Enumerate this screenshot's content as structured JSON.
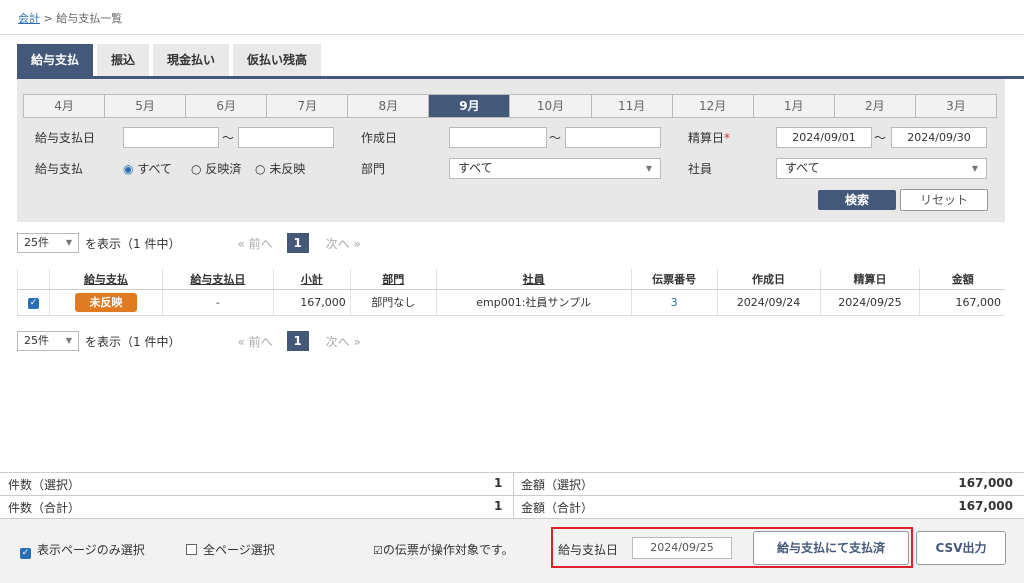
{
  "breadcrumb": {
    "root": "会計",
    "separator": ">",
    "current": "給与支払一覧"
  },
  "tabs": [
    "給与支払",
    "振込",
    "現金払い",
    "仮払い残高"
  ],
  "months": [
    "4月",
    "5月",
    "6月",
    "7月",
    "8月",
    "9月",
    "10月",
    "11月",
    "12月",
    "1月",
    "2月",
    "3月"
  ],
  "active_month": "9月",
  "filter": {
    "pay_date_label": "給与支払日",
    "pay_date_from": "",
    "pay_date_to": "",
    "created_label": "作成日",
    "created_from": "",
    "created_to": "",
    "settle_label": "精算日",
    "required_mark": "*",
    "settle_from": "2024/09/01",
    "settle_to": "2024/09/30",
    "tilde": "～",
    "payment_label": "給与支払",
    "radio_all": "すべて",
    "radio_applied": "反映済",
    "radio_unapplied": "未反映",
    "dept_label": "部門",
    "dept_value": "すべて",
    "employee_label": "社員",
    "employee_value": "すべて",
    "search_label": "検索",
    "reset_label": "リセット"
  },
  "pager": {
    "per_page": "25件",
    "display_text": "を表示（1 件中）",
    "prev": "« 前へ",
    "page": "1",
    "next": "次へ »"
  },
  "table": {
    "headers": [
      "給与支払",
      "給与支払日",
      "小計",
      "部門",
      "社員",
      "伝票番号",
      "作成日",
      "精算日",
      "金額"
    ],
    "rows": [
      {
        "status": "未反映",
        "pay_date": "-",
        "subtotal": "167,000",
        "dept": "部門なし",
        "employee": "emp001:社員サンプル",
        "voucher": "3",
        "created": "2024/09/24",
        "settled": "2024/09/25",
        "amount": "167,000"
      }
    ]
  },
  "summary": {
    "count_selected_label": "件数（選択）",
    "count_selected": "1",
    "amount_selected_label": "金額（選択）",
    "amount_selected": "167,000",
    "count_total_label": "件数（合計）",
    "count_total": "1",
    "amount_total_label": "金額（合計）",
    "amount_total": "167,000"
  },
  "bottom": {
    "page_only": "表示ページのみ選択",
    "all_pages": "全ページ選択",
    "target_note": "の伝票が操作対象です。",
    "pay_date_label": "給与支払日",
    "pay_date_value": "2024/09/25",
    "paid_button": "給与支払にて支払済",
    "csv_button": "CSV出力"
  },
  "colors": {
    "accent": "#44597a",
    "badge": "#e07b24",
    "highlight": "#e0202a"
  }
}
